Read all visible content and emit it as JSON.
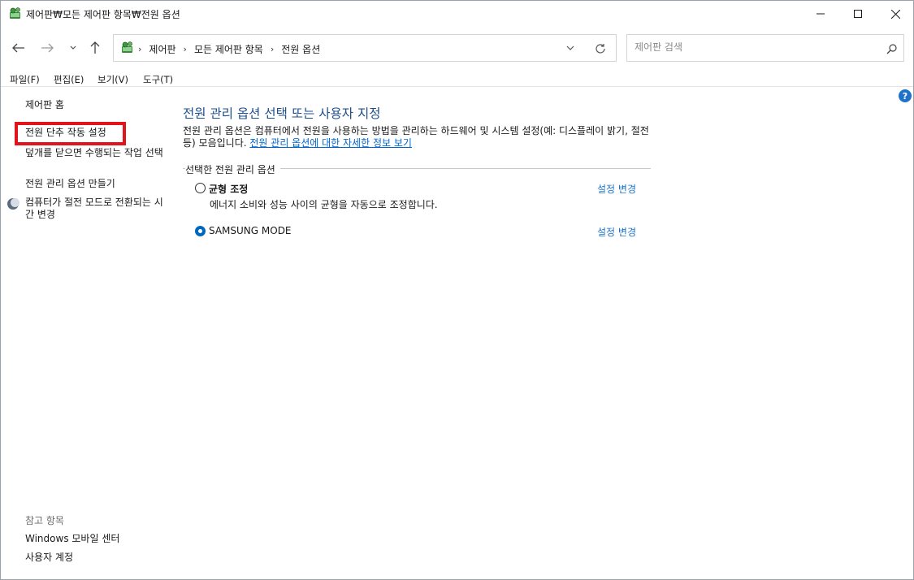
{
  "window": {
    "title": "제어판₩모든 제어판 항목₩전원 옵션",
    "icon": "control-panel-icon"
  },
  "nav": {
    "breadcrumbs": [
      "제어판",
      "모든 제어판 항목",
      "전원 옵션"
    ],
    "search_placeholder": "제어판 검색"
  },
  "menu": {
    "items": [
      "파일(F)",
      "편집(E)",
      "보기(V)",
      "도구(T)"
    ]
  },
  "sidebar": {
    "home": "제어판 홈",
    "links": [
      "전원 단추 작동 설정",
      "덮개를 닫으면 수행되는 작업 선택",
      "전원 관리 옵션 만들기",
      "컴퓨터가 절전 모드로 전환되는 시간 변경"
    ],
    "see_also_title": "참고 항목",
    "see_also": [
      "Windows 모바일 센터",
      "사용자 계정"
    ],
    "highlight_color": "#e3131b"
  },
  "main": {
    "title": "전원 관리 옵션 선택 또는 사용자 지정",
    "description": "전원 관리 옵션은 컴퓨터에서 전원을 사용하는 방법을 관리하는 하드웨어 및 시스템 설정(예: 디스플레이 밝기, 절전 등) 모음입니다.",
    "description_link": "전원 관리 옵션에 대한 자세한 정보 보기",
    "plans_header": "선택한 전원 관리 옵션",
    "plans": [
      {
        "name": "균형 조정",
        "description": "에너지 소비와 성능 사이의 균형을 자동으로 조정합니다.",
        "change_link": "설정 변경",
        "selected": false
      },
      {
        "name": "SAMSUNG MODE",
        "description": "",
        "change_link": "설정 변경",
        "selected": true
      }
    ]
  },
  "colors": {
    "title_blue": "#1e4e8c",
    "link_blue": "#1e73c8",
    "radio_accent": "#0067c0"
  }
}
